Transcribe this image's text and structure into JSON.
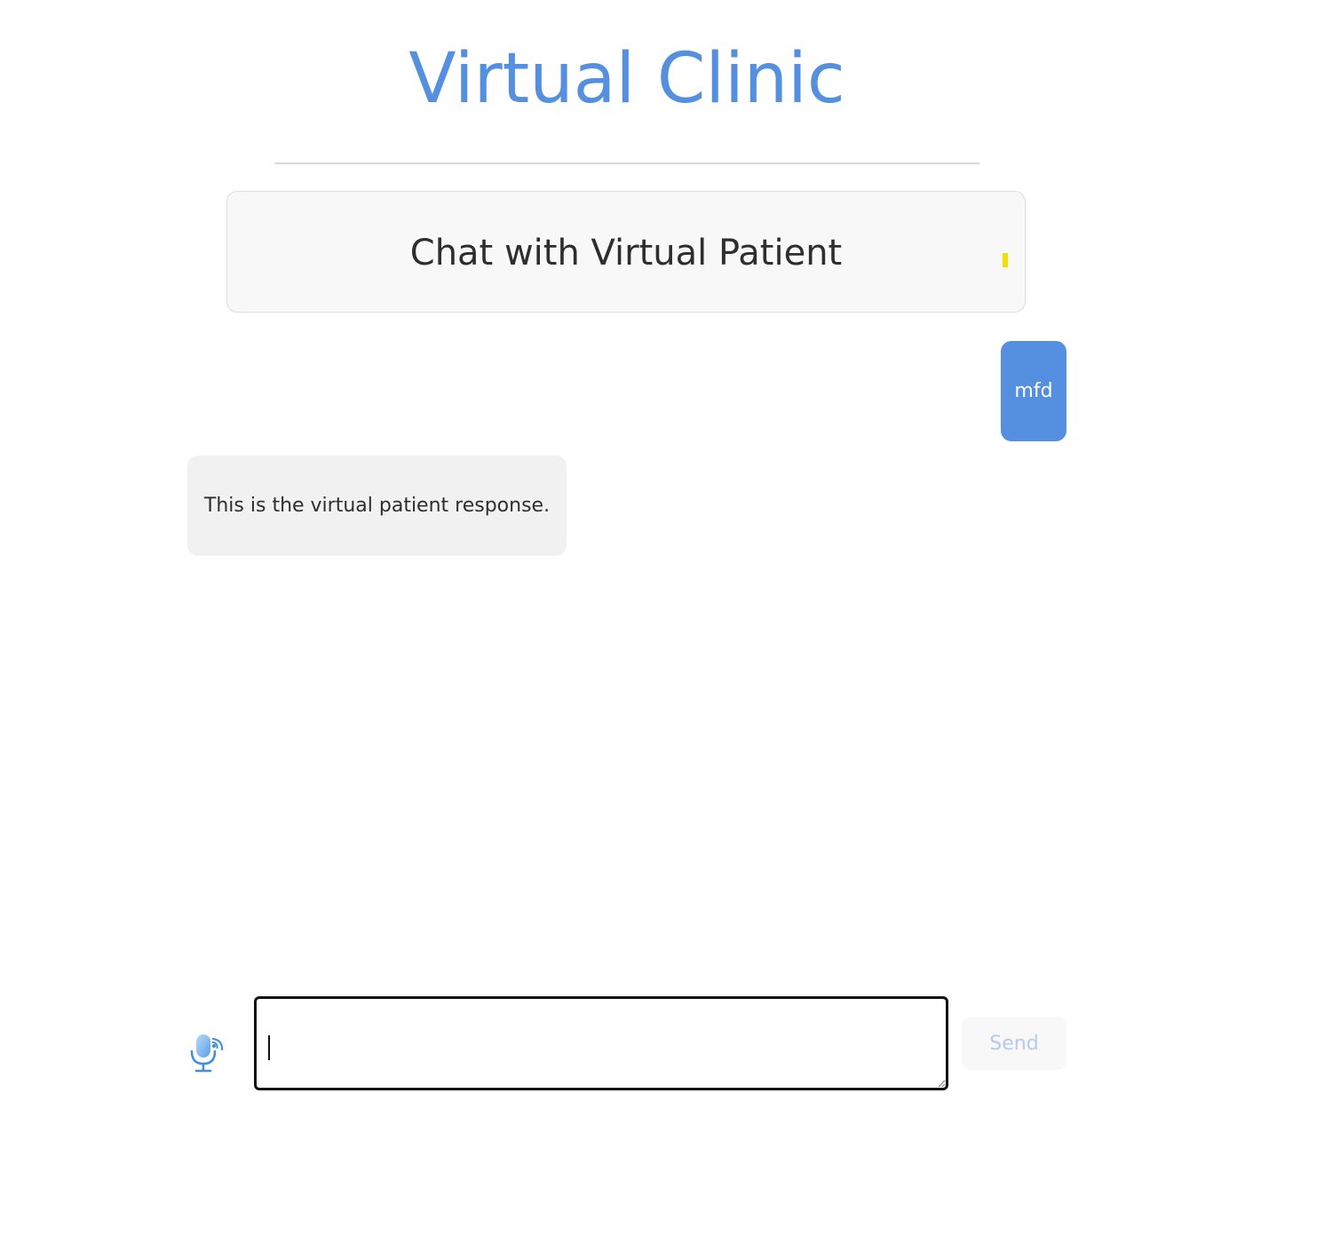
{
  "app": {
    "title": "Virtual Clinic",
    "accent_color": "#5590e0"
  },
  "chat": {
    "header_title": "Chat with Virtual Patient",
    "status_indicator_color": "#f2df00",
    "messages": [
      {
        "sender": "user",
        "text": "mfd"
      },
      {
        "sender": "patient",
        "text": "This is the virtual patient response."
      }
    ]
  },
  "composer": {
    "input_value": "",
    "mic_icon": "microphone-icon",
    "send_label": "Send",
    "send_enabled": false
  }
}
